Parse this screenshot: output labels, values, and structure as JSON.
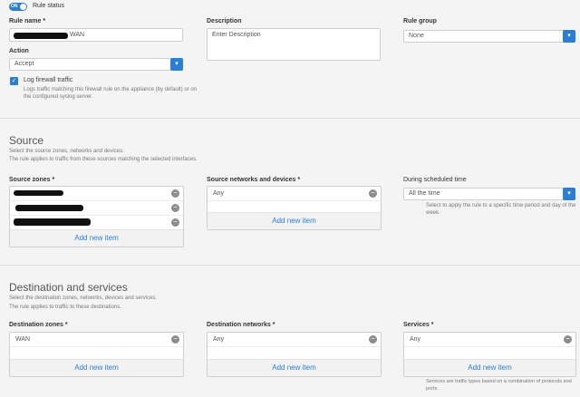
{
  "rule_status": {
    "toggle_label": "ON",
    "label": "Rule status"
  },
  "rule_name": {
    "label": "Rule name *",
    "value": "WAN"
  },
  "description": {
    "label": "Description",
    "placeholder": "Enter Description"
  },
  "rule_group": {
    "label": "Rule group",
    "value": "None"
  },
  "action": {
    "label": "Action",
    "value": "Accept"
  },
  "log_traffic": {
    "label": "Log firewall traffic",
    "help": "Logs traffic matching this firewall rule on the appliance (by default) or on the configured syslog server."
  },
  "source": {
    "title": "Source",
    "line1": "Select the source zones, networks and devices.",
    "line2": "The rule applies to traffic from these sources matching the selected interfaces."
  },
  "source_zones": {
    "label": "Source zones *",
    "add": "Add new item"
  },
  "source_networks": {
    "label": "Source networks and devices *",
    "item": "Any",
    "add": "Add new item"
  },
  "schedule": {
    "label": "During scheduled time",
    "value": "All the time",
    "help": "Select to apply the rule to a specific time period and day of the week."
  },
  "destination": {
    "title": "Destination and services",
    "line1": "Select the destination zones, networks, devices and services.",
    "line2": "The rule applies to traffic to these destinations."
  },
  "destination_zones": {
    "label": "Destination zones *",
    "item": "WAN",
    "add": "Add new item"
  },
  "destination_networks": {
    "label": "Destination networks *",
    "item": "Any",
    "add": "Add new item"
  },
  "services": {
    "label": "Services *",
    "item": "Any",
    "add": "Add new item",
    "help": "Services are traffic types based on a combination of protocols and ports."
  },
  "colors": {
    "accent": "#2a7fd4"
  }
}
